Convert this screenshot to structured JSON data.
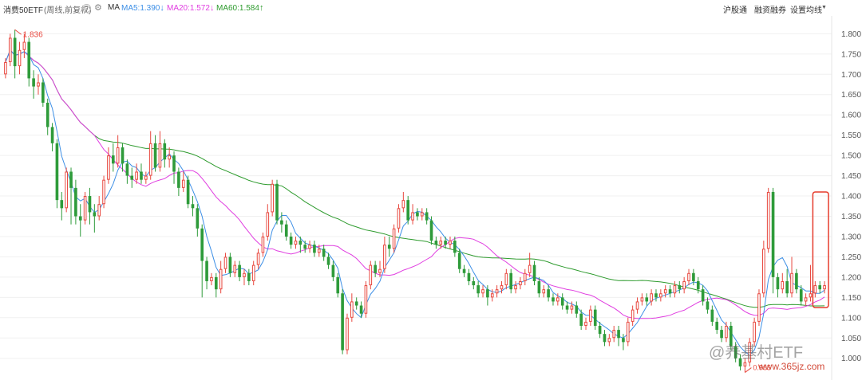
{
  "header": {
    "title": "消费50ETF",
    "subtitle": "(周线,前复权)",
    "ma_label": "MA",
    "ma5": "MA5:1.390",
    "ma20": "MA20:1.572",
    "ma60": "MA60:1.584",
    "ma5_arrow": "↓",
    "ma20_arrow": "↓",
    "ma60_arrow": "↑",
    "link1": "沪股通",
    "link2": "融资融券",
    "link3": "设置均线",
    "colors": {
      "ma5": "#3d8fe6",
      "ma20": "#e03ee0",
      "ma60": "#2e9b2e",
      "up": "#e8483f",
      "down": "#2e9b3a"
    }
  },
  "watermark": {
    "text": "@养基村ETF",
    "url": "www.365jz.com"
  },
  "chart_data": {
    "type": "candlestick",
    "title": "消费50ETF",
    "y_ticks": [
      "1.800",
      "1.750",
      "1.700",
      "1.650",
      "1.600",
      "1.550",
      "1.500",
      "1.450",
      "1.400",
      "1.350",
      "1.300",
      "1.250",
      "1.200",
      "1.150",
      "1.100",
      "1.050",
      "1.000"
    ],
    "ylim": [
      0.97,
      1.84
    ],
    "annotations": {
      "high": "1.836",
      "low": "0.965"
    },
    "highlight_box": {
      "x_range": [
        174,
        195
      ],
      "y_range": [
        1.125,
        1.41
      ]
    },
    "candles": [
      [
        1.7,
        1.73,
        1.69,
        1.74
      ],
      [
        1.73,
        1.79,
        1.72,
        1.8
      ],
      [
        1.79,
        1.72,
        1.69,
        1.81
      ],
      [
        1.72,
        1.76,
        1.7,
        1.78
      ],
      [
        1.76,
        1.78,
        1.74,
        1.8
      ],
      [
        1.78,
        1.69,
        1.67,
        1.79
      ],
      [
        1.69,
        1.67,
        1.64,
        1.71
      ],
      [
        1.67,
        1.68,
        1.65,
        1.7
      ],
      [
        1.68,
        1.63,
        1.62,
        1.69
      ],
      [
        1.63,
        1.57,
        1.55,
        1.64
      ],
      [
        1.57,
        1.53,
        1.51,
        1.58
      ],
      [
        1.53,
        1.39,
        1.37,
        1.54
      ],
      [
        1.39,
        1.37,
        1.34,
        1.41
      ],
      [
        1.37,
        1.46,
        1.36,
        1.47
      ],
      [
        1.46,
        1.42,
        1.33,
        1.47
      ],
      [
        1.42,
        1.35,
        1.33,
        1.44
      ],
      [
        1.35,
        1.34,
        1.3,
        1.38
      ],
      [
        1.34,
        1.4,
        1.33,
        1.41
      ],
      [
        1.4,
        1.36,
        1.33,
        1.42
      ],
      [
        1.36,
        1.35,
        1.31,
        1.38
      ],
      [
        1.35,
        1.38,
        1.34,
        1.4
      ],
      [
        1.38,
        1.44,
        1.37,
        1.45
      ],
      [
        1.44,
        1.5,
        1.43,
        1.52
      ],
      [
        1.5,
        1.48,
        1.46,
        1.53
      ],
      [
        1.48,
        1.52,
        1.47,
        1.55
      ],
      [
        1.52,
        1.48,
        1.46,
        1.53
      ],
      [
        1.48,
        1.45,
        1.43,
        1.49
      ],
      [
        1.45,
        1.44,
        1.42,
        1.47
      ],
      [
        1.44,
        1.46,
        1.43,
        1.48
      ],
      [
        1.46,
        1.44,
        1.43,
        1.48
      ],
      [
        1.44,
        1.45,
        1.43,
        1.46
      ],
      [
        1.45,
        1.53,
        1.44,
        1.56
      ],
      [
        1.53,
        1.47,
        1.46,
        1.55
      ],
      [
        1.47,
        1.53,
        1.46,
        1.56
      ],
      [
        1.53,
        1.49,
        1.47,
        1.54
      ],
      [
        1.49,
        1.5,
        1.47,
        1.52
      ],
      [
        1.5,
        1.46,
        1.43,
        1.51
      ],
      [
        1.46,
        1.42,
        1.4,
        1.47
      ],
      [
        1.42,
        1.44,
        1.41,
        1.46
      ],
      [
        1.44,
        1.38,
        1.37,
        1.45
      ],
      [
        1.38,
        1.37,
        1.35,
        1.4
      ],
      [
        1.37,
        1.32,
        1.3,
        1.38
      ],
      [
        1.32,
        1.24,
        1.15,
        1.33
      ],
      [
        1.24,
        1.19,
        1.17,
        1.25
      ],
      [
        1.19,
        1.2,
        1.18,
        1.21
      ],
      [
        1.2,
        1.17,
        1.15,
        1.21
      ],
      [
        1.17,
        1.22,
        1.16,
        1.24
      ],
      [
        1.22,
        1.25,
        1.21,
        1.26
      ],
      [
        1.25,
        1.21,
        1.2,
        1.26
      ],
      [
        1.21,
        1.23,
        1.2,
        1.24
      ],
      [
        1.23,
        1.2,
        1.19,
        1.24
      ],
      [
        1.2,
        1.21,
        1.18,
        1.22
      ],
      [
        1.21,
        1.19,
        1.18,
        1.22
      ],
      [
        1.19,
        1.23,
        1.18,
        1.24
      ],
      [
        1.23,
        1.26,
        1.22,
        1.27
      ],
      [
        1.26,
        1.3,
        1.25,
        1.31
      ],
      [
        1.3,
        1.36,
        1.29,
        1.38
      ],
      [
        1.36,
        1.43,
        1.35,
        1.44
      ],
      [
        1.43,
        1.34,
        1.33,
        1.44
      ],
      [
        1.34,
        1.33,
        1.31,
        1.36
      ],
      [
        1.33,
        1.3,
        1.29,
        1.34
      ],
      [
        1.3,
        1.28,
        1.27,
        1.31
      ],
      [
        1.28,
        1.29,
        1.27,
        1.3
      ],
      [
        1.29,
        1.28,
        1.26,
        1.3
      ],
      [
        1.28,
        1.27,
        1.26,
        1.29
      ],
      [
        1.27,
        1.28,
        1.26,
        1.29
      ],
      [
        1.28,
        1.26,
        1.25,
        1.29
      ],
      [
        1.26,
        1.27,
        1.25,
        1.28
      ],
      [
        1.27,
        1.25,
        1.24,
        1.28
      ],
      [
        1.25,
        1.23,
        1.22,
        1.26
      ],
      [
        1.23,
        1.2,
        1.19,
        1.24
      ],
      [
        1.2,
        1.16,
        1.15,
        1.21
      ],
      [
        1.16,
        1.02,
        1.01,
        1.17
      ],
      [
        1.02,
        1.1,
        1.01,
        1.11
      ],
      [
        1.1,
        1.14,
        1.09,
        1.16
      ],
      [
        1.14,
        1.13,
        1.12,
        1.15
      ],
      [
        1.13,
        1.11,
        1.1,
        1.14
      ],
      [
        1.11,
        1.18,
        1.1,
        1.19
      ],
      [
        1.18,
        1.23,
        1.17,
        1.24
      ],
      [
        1.23,
        1.21,
        1.2,
        1.24
      ],
      [
        1.21,
        1.22,
        1.2,
        1.24
      ],
      [
        1.22,
        1.28,
        1.21,
        1.3
      ],
      [
        1.28,
        1.27,
        1.25,
        1.3
      ],
      [
        1.27,
        1.32,
        1.26,
        1.33
      ],
      [
        1.32,
        1.37,
        1.31,
        1.38
      ],
      [
        1.37,
        1.39,
        1.36,
        1.41
      ],
      [
        1.39,
        1.34,
        1.33,
        1.4
      ],
      [
        1.34,
        1.36,
        1.33,
        1.38
      ],
      [
        1.36,
        1.35,
        1.34,
        1.37
      ],
      [
        1.35,
        1.36,
        1.34,
        1.37
      ],
      [
        1.36,
        1.34,
        1.33,
        1.37
      ],
      [
        1.34,
        1.29,
        1.28,
        1.35
      ],
      [
        1.29,
        1.28,
        1.27,
        1.3
      ],
      [
        1.28,
        1.29,
        1.27,
        1.3
      ],
      [
        1.29,
        1.28,
        1.27,
        1.3
      ],
      [
        1.28,
        1.29,
        1.27,
        1.3
      ],
      [
        1.29,
        1.26,
        1.25,
        1.3
      ],
      [
        1.26,
        1.22,
        1.21,
        1.27
      ],
      [
        1.22,
        1.21,
        1.2,
        1.23
      ],
      [
        1.21,
        1.19,
        1.18,
        1.22
      ],
      [
        1.19,
        1.18,
        1.17,
        1.2
      ],
      [
        1.18,
        1.16,
        1.15,
        1.19
      ],
      [
        1.16,
        1.17,
        1.15,
        1.18
      ],
      [
        1.17,
        1.15,
        1.13,
        1.18
      ],
      [
        1.15,
        1.16,
        1.14,
        1.17
      ],
      [
        1.16,
        1.17,
        1.15,
        1.18
      ],
      [
        1.17,
        1.18,
        1.16,
        1.19
      ],
      [
        1.18,
        1.21,
        1.17,
        1.22
      ],
      [
        1.21,
        1.17,
        1.16,
        1.22
      ],
      [
        1.17,
        1.18,
        1.16,
        1.19
      ],
      [
        1.18,
        1.19,
        1.17,
        1.2
      ],
      [
        1.19,
        1.21,
        1.18,
        1.22
      ],
      [
        1.21,
        1.23,
        1.2,
        1.26
      ],
      [
        1.23,
        1.19,
        1.18,
        1.24
      ],
      [
        1.19,
        1.16,
        1.15,
        1.2
      ],
      [
        1.16,
        1.17,
        1.15,
        1.18
      ],
      [
        1.17,
        1.15,
        1.14,
        1.18
      ],
      [
        1.15,
        1.14,
        1.13,
        1.16
      ],
      [
        1.14,
        1.15,
        1.13,
        1.16
      ],
      [
        1.15,
        1.13,
        1.12,
        1.16
      ],
      [
        1.13,
        1.12,
        1.11,
        1.14
      ],
      [
        1.12,
        1.13,
        1.11,
        1.14
      ],
      [
        1.13,
        1.11,
        1.1,
        1.14
      ],
      [
        1.11,
        1.08,
        1.07,
        1.12
      ],
      [
        1.08,
        1.09,
        1.07,
        1.1
      ],
      [
        1.09,
        1.12,
        1.08,
        1.13
      ],
      [
        1.12,
        1.08,
        1.07,
        1.13
      ],
      [
        1.08,
        1.06,
        1.05,
        1.09
      ],
      [
        1.06,
        1.04,
        1.03,
        1.07
      ],
      [
        1.04,
        1.05,
        1.03,
        1.06
      ],
      [
        1.05,
        1.07,
        1.04,
        1.08
      ],
      [
        1.07,
        1.05,
        1.03,
        1.08
      ],
      [
        1.05,
        1.04,
        1.02,
        1.06
      ],
      [
        1.04,
        1.09,
        1.03,
        1.1
      ],
      [
        1.09,
        1.12,
        1.08,
        1.13
      ],
      [
        1.12,
        1.14,
        1.11,
        1.15
      ],
      [
        1.14,
        1.15,
        1.13,
        1.16
      ],
      [
        1.15,
        1.14,
        1.13,
        1.16
      ],
      [
        1.14,
        1.16,
        1.13,
        1.17
      ],
      [
        1.16,
        1.15,
        1.14,
        1.17
      ],
      [
        1.15,
        1.16,
        1.14,
        1.17
      ],
      [
        1.16,
        1.17,
        1.15,
        1.18
      ],
      [
        1.17,
        1.16,
        1.15,
        1.18
      ],
      [
        1.16,
        1.18,
        1.15,
        1.19
      ],
      [
        1.18,
        1.17,
        1.16,
        1.19
      ],
      [
        1.17,
        1.19,
        1.16,
        1.2
      ],
      [
        1.19,
        1.21,
        1.18,
        1.22
      ],
      [
        1.21,
        1.19,
        1.18,
        1.22
      ],
      [
        1.19,
        1.17,
        1.16,
        1.2
      ],
      [
        1.17,
        1.14,
        1.13,
        1.18
      ],
      [
        1.14,
        1.12,
        1.11,
        1.15
      ],
      [
        1.12,
        1.09,
        1.08,
        1.13
      ],
      [
        1.09,
        1.07,
        1.06,
        1.1
      ],
      [
        1.07,
        1.05,
        1.04,
        1.08
      ],
      [
        1.05,
        1.08,
        1.04,
        1.09
      ],
      [
        1.08,
        1.03,
        1.02,
        1.09
      ],
      [
        1.03,
        1.0,
        0.99,
        1.04
      ],
      [
        1.0,
        0.98,
        0.97,
        1.01
      ],
      [
        0.98,
        0.99,
        0.965,
        1.0
      ],
      [
        0.99,
        1.04,
        0.98,
        1.05
      ],
      [
        1.04,
        1.09,
        1.03,
        1.1
      ],
      [
        1.09,
        1.16,
        1.08,
        1.17
      ],
      [
        1.16,
        1.27,
        1.15,
        1.29
      ],
      [
        1.27,
        1.41,
        1.26,
        1.42
      ],
      [
        1.41,
        1.2,
        1.16,
        1.42
      ],
      [
        1.2,
        1.17,
        1.15,
        1.21
      ],
      [
        1.17,
        1.19,
        1.16,
        1.21
      ],
      [
        1.19,
        1.16,
        1.15,
        1.22
      ],
      [
        1.16,
        1.21,
        1.15,
        1.25
      ],
      [
        1.21,
        1.17,
        1.16,
        1.22
      ],
      [
        1.17,
        1.14,
        1.13,
        1.18
      ],
      [
        1.14,
        1.15,
        1.13,
        1.16
      ],
      [
        1.15,
        1.16,
        1.14,
        1.23
      ],
      [
        1.16,
        1.18,
        1.15,
        1.19
      ],
      [
        1.18,
        1.17,
        1.16,
        1.19
      ],
      [
        1.17,
        1.18,
        1.16,
        1.19
      ]
    ]
  }
}
